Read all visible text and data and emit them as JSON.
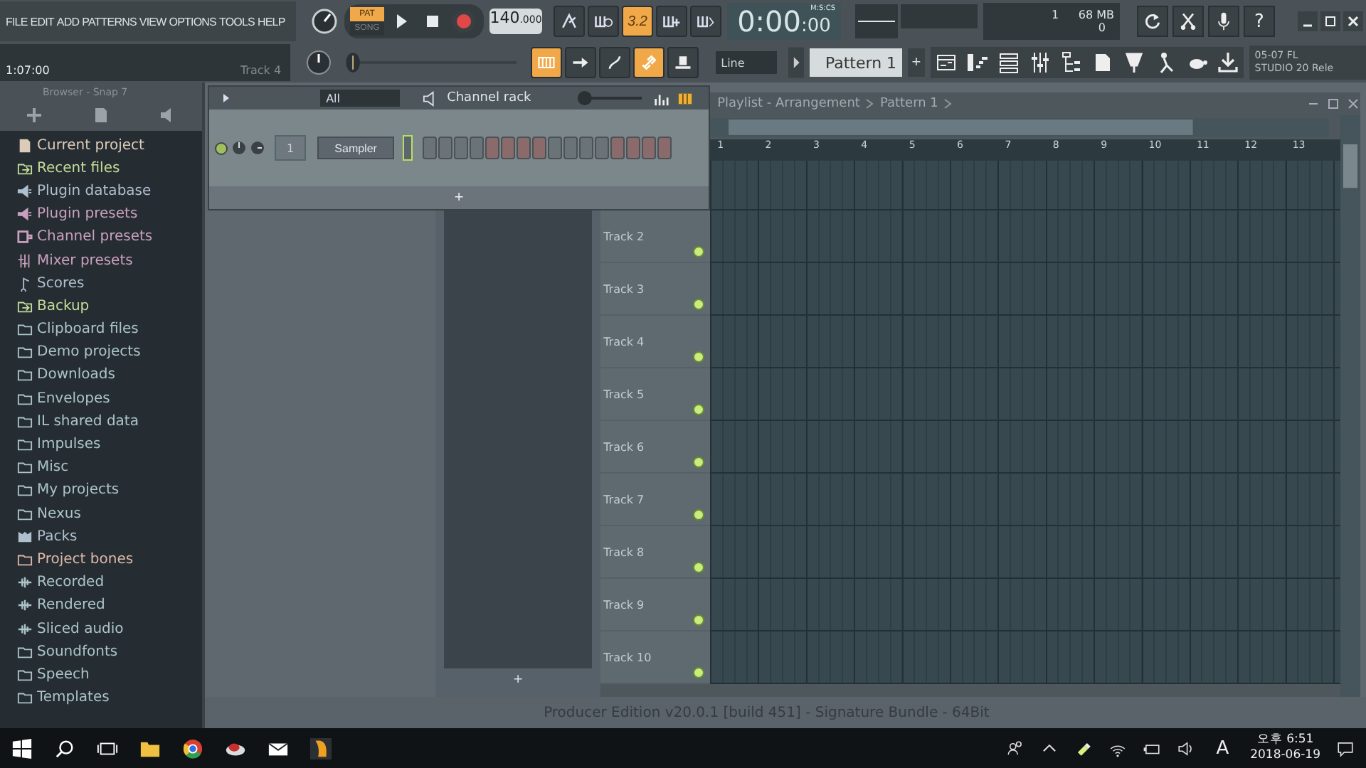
{
  "menu": [
    "FILE",
    "EDIT",
    "ADD",
    "PATTERNS",
    "VIEW",
    "OPTIONS",
    "TOOLS",
    "HELP"
  ],
  "modes": [
    {
      "label": "PAT",
      "selected": true
    },
    {
      "label": "SONG",
      "selected": false
    }
  ],
  "tempo": {
    "whole": "140",
    "fraction": ".000"
  },
  "toolbar_top": [
    {
      "kind": "metronome",
      "on": false
    },
    {
      "kind": "wait",
      "on": false
    },
    {
      "kind": "countdown",
      "on": true,
      "glyph": "3.2"
    },
    {
      "kind": "step",
      "on": false
    },
    {
      "kind": "blend",
      "on": false
    }
  ],
  "time": {
    "main": "0:00",
    "sub": ":00",
    "unit": "M:S:CS"
  },
  "cpu": "1",
  "memory": "68 MB",
  "polyphony": "0",
  "help_glyph": "?",
  "hint": {
    "text": "1:07:00",
    "target": "Track 4"
  },
  "pitch_slider": {
    "level": 0.02
  },
  "toolbar_bottom": [
    {
      "kind": "keyboard",
      "on": true
    },
    {
      "kind": "arrow",
      "on": false
    },
    {
      "kind": "loop",
      "on": false
    },
    {
      "kind": "link",
      "on": true
    },
    {
      "kind": "hat",
      "on": false
    }
  ],
  "snap": "Line",
  "pattern": {
    "name": "Pattern 1",
    "add": "+"
  },
  "news": {
    "line1": "05-07  FL",
    "line2": "STUDIO 20 Rele"
  },
  "browser": {
    "title": "Browser - Snap 7",
    "items": [
      {
        "label": "Current project",
        "kind": "file",
        "color": "#dccbb8"
      },
      {
        "label": "Recent files",
        "kind": "recent",
        "color": "#c2dc98"
      },
      {
        "label": "Plugin database",
        "kind": "plugin",
        "color": "#aebfce"
      },
      {
        "label": "Plugin presets",
        "kind": "plugin",
        "color": "#c9a0bd"
      },
      {
        "label": "Channel presets",
        "kind": "channel",
        "color": "#c9a0bd"
      },
      {
        "label": "Mixer presets",
        "kind": "mixer",
        "color": "#c9a0bd"
      },
      {
        "label": "Scores",
        "kind": "note",
        "color": "#aebfce"
      },
      {
        "label": "Backup",
        "kind": "recent",
        "color": "#c2dc98"
      },
      {
        "label": "Clipboard files",
        "kind": "folder",
        "color": "#aac4c8"
      },
      {
        "label": "Demo projects",
        "kind": "folder",
        "color": "#aac4c8"
      },
      {
        "label": "Downloads",
        "kind": "folder",
        "color": "#aac4c8"
      },
      {
        "label": "Envelopes",
        "kind": "folder",
        "color": "#aac4c8"
      },
      {
        "label": "IL shared data",
        "kind": "folder",
        "color": "#aac4c8"
      },
      {
        "label": "Impulses",
        "kind": "folder",
        "color": "#aac4c8"
      },
      {
        "label": "Misc",
        "kind": "folder",
        "color": "#aac4c8"
      },
      {
        "label": "My projects",
        "kind": "folder",
        "color": "#aac4c8"
      },
      {
        "label": "Nexus",
        "kind": "folder",
        "color": "#aac4c8"
      },
      {
        "label": "Packs",
        "kind": "packs",
        "color": "#aebfce"
      },
      {
        "label": "Project bones",
        "kind": "folder",
        "color": "#dcb8a8"
      },
      {
        "label": "Recorded",
        "kind": "audio",
        "color": "#aac4c8"
      },
      {
        "label": "Rendered",
        "kind": "audio",
        "color": "#aac4c8"
      },
      {
        "label": "Sliced audio",
        "kind": "audio",
        "color": "#aac4c8"
      },
      {
        "label": "Soundfonts",
        "kind": "folder",
        "color": "#aac4c8"
      },
      {
        "label": "Speech",
        "kind": "folder",
        "color": "#aac4c8"
      },
      {
        "label": "Templates",
        "kind": "folder",
        "color": "#aac4c8"
      }
    ]
  },
  "channel_rack": {
    "title": "Channel rack",
    "filter": "All",
    "add": "+",
    "swing": {
      "level": 0.05
    },
    "channels": [
      {
        "number": "1",
        "name": "Sampler",
        "selected": true
      }
    ]
  },
  "playlist": {
    "title": "Playlist - Arrangement",
    "pattern": "Pattern 1",
    "add": "+",
    "ruler": [
      "1",
      "2",
      "3",
      "4",
      "5",
      "6",
      "7",
      "8",
      "9",
      "10",
      "11",
      "12",
      "13"
    ],
    "tracks": [
      {
        "name": "Track 2",
        "on": true
      },
      {
        "name": "Track 3",
        "on": true
      },
      {
        "name": "Track 4",
        "on": true
      },
      {
        "name": "Track 5",
        "on": true
      },
      {
        "name": "Track 6",
        "on": true
      },
      {
        "name": "Track 7",
        "on": true
      },
      {
        "name": "Track 8",
        "on": true
      },
      {
        "name": "Track 9",
        "on": true
      },
      {
        "name": "Track 10",
        "on": true
      }
    ]
  },
  "status": "Producer Edition v20.0.1 [build 451] - Signature Bundle - 64Bit",
  "taskbar": {
    "ime": "A",
    "time": "오후 6:51",
    "date": "2018-06-19"
  }
}
